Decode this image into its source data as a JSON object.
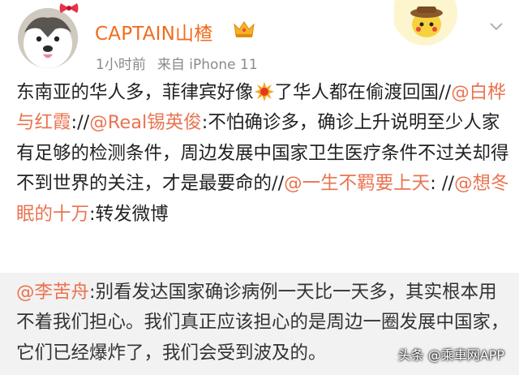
{
  "post": {
    "username": "CAPTAIN山楂",
    "time": "1小时前",
    "source": "来自 iPhone 11",
    "avatar_icon": "husky-dog-avatar",
    "badge_icon": "crown-vip-icon",
    "content": {
      "t1": "东南亚的华人多，菲律宾好像",
      "emoji": "explosion-emoji",
      "t2": "了华人都在偷渡回国//",
      "m1": "@白桦与红霞",
      "t3": "://",
      "m2": "@Real锡英俊",
      "t4": ":不怕确诊多，确诊上升说明至少人家有足够的检测条件，周边发展中国家卫生医疗条件不过关却得不到世界的关注，才是最要命的//",
      "m3": "@一生不羁要上天",
      "t5": ": //",
      "m4": "@想冬眠的十万",
      "t6": ":转发微博"
    }
  },
  "repost": {
    "author": "@李苦舟",
    "text": ":别看发达国家确诊病例一天比一天多，其实根本用不着我们担心。我们真正应该担心的是周边一圈发展中国家，它们已经爆炸了，我们会受到波及的。"
  },
  "watermark": "头条 @乘車网APP",
  "colors": {
    "username": "#f26b1d",
    "mention": "#eb7350",
    "meta": "#8a8a8a",
    "repost_bg": "#f2f2f2"
  }
}
